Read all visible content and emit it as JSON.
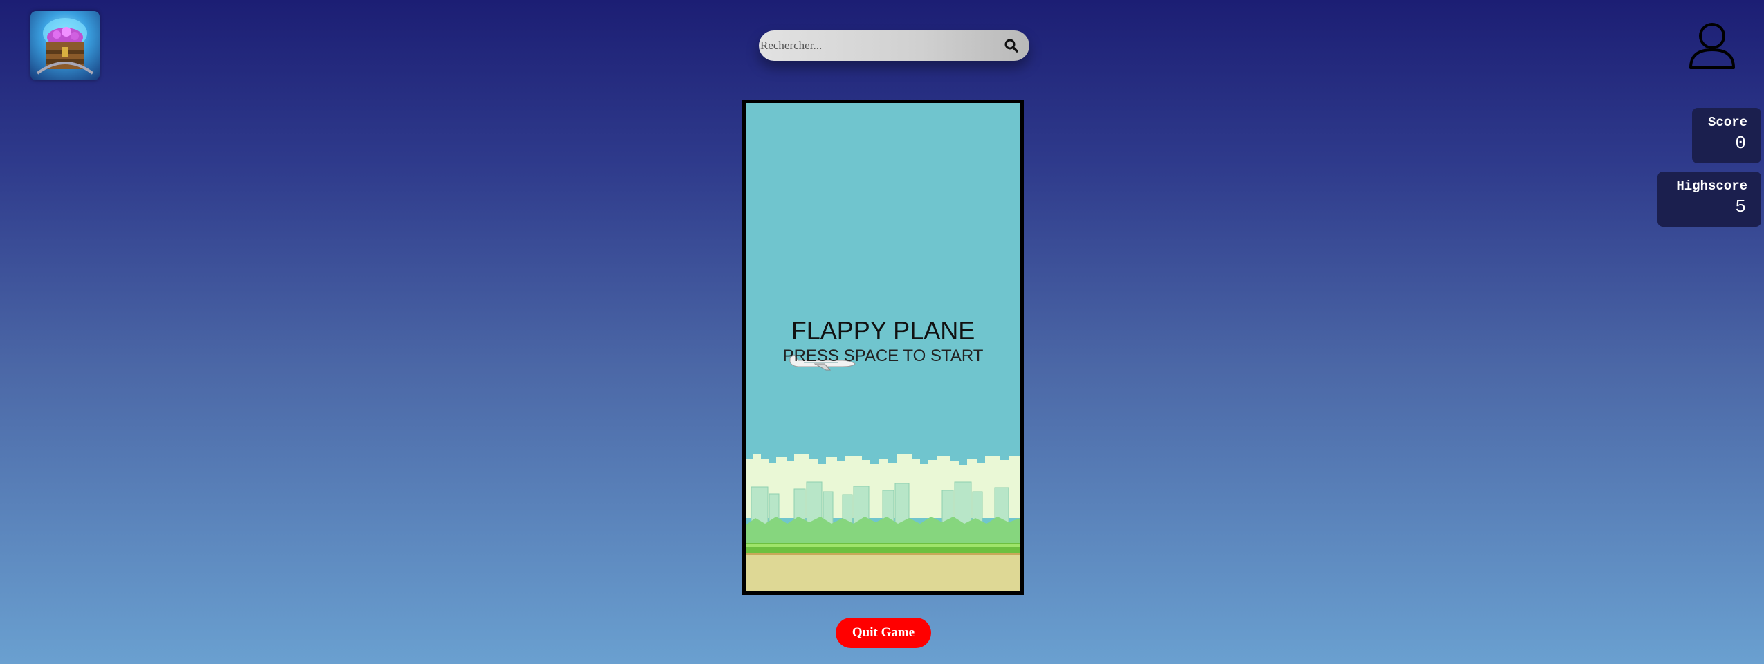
{
  "header": {
    "logo_icon": "treasure-chest-logo-icon",
    "search": {
      "placeholder": "Rechercher...",
      "value": "",
      "icon": "search-icon"
    },
    "user_icon": "user-icon"
  },
  "scoreboard": {
    "score": {
      "label": "Score",
      "value": "0"
    },
    "highscore": {
      "label": "Highscore",
      "value": "5"
    }
  },
  "game": {
    "title": "FLAPPY PLANE",
    "subtitle": "PRESS SPACE TO START",
    "sprite": "airplane-icon",
    "colors": {
      "sky": "#70c5ce",
      "clouds": "#eaf8d6",
      "buildings": "#b8e6c8",
      "bushes": "#86d67e",
      "grass": "#6dc040",
      "ground": "#ded895"
    }
  },
  "footer": {
    "quit_label": "Quit Game",
    "quit_color": "#ff0000"
  }
}
